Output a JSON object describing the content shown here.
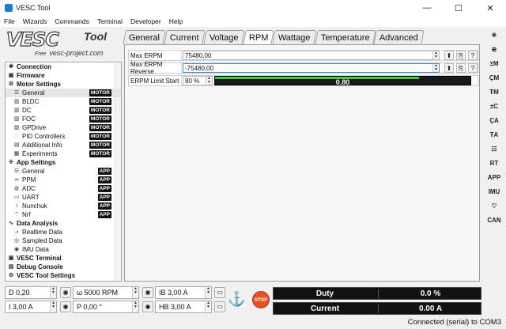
{
  "window": {
    "title": "VESC Tool",
    "controls": [
      "—",
      "☐",
      "✕"
    ]
  },
  "menu": [
    "File",
    "Wizards",
    "Commands",
    "Terminal",
    "Developer",
    "Help"
  ],
  "logo": {
    "brand": "VESC",
    "tool": "Tool",
    "free": "Free",
    "site": "vesc-project.com"
  },
  "tree": [
    {
      "kind": "group",
      "label": "Connection",
      "icon": "connection-icon"
    },
    {
      "kind": "group",
      "label": "Firmware",
      "icon": "firmware-icon"
    },
    {
      "kind": "group",
      "label": "Motor Settings",
      "icon": "motor-settings-icon"
    },
    {
      "kind": "child",
      "label": "General",
      "icon": "sliders-icon",
      "badge": "MOTOR",
      "selected": true
    },
    {
      "kind": "child",
      "label": "BLDC",
      "icon": "bldc-icon",
      "badge": "MOTOR"
    },
    {
      "kind": "child",
      "label": "DC",
      "icon": "dc-icon",
      "badge": "MOTOR"
    },
    {
      "kind": "child",
      "label": "FOC",
      "icon": "foc-icon",
      "badge": "MOTOR"
    },
    {
      "kind": "child",
      "label": "GPDrive",
      "icon": "gpdrive-icon",
      "badge": "MOTOR"
    },
    {
      "kind": "child",
      "label": "PID Controllers",
      "icon": "pid-icon",
      "badge": "MOTOR"
    },
    {
      "kind": "child",
      "label": "Additional Info",
      "icon": "info-icon",
      "badge": "MOTOR"
    },
    {
      "kind": "child",
      "label": "Experiments",
      "icon": "experiments-icon",
      "badge": "MOTOR"
    },
    {
      "kind": "group",
      "label": "App Settings",
      "icon": "app-settings-icon"
    },
    {
      "kind": "child",
      "label": "General",
      "icon": "sliders-icon",
      "badge": "APP"
    },
    {
      "kind": "child",
      "label": "PPM",
      "icon": "ppm-icon",
      "badge": "APP"
    },
    {
      "kind": "child",
      "label": "ADC",
      "icon": "adc-icon",
      "badge": "APP"
    },
    {
      "kind": "child",
      "label": "UART",
      "icon": "uart-icon",
      "badge": "APP"
    },
    {
      "kind": "child",
      "label": "Nunchuk",
      "icon": "nunchuk-icon",
      "badge": "APP"
    },
    {
      "kind": "child",
      "label": "Nrf",
      "icon": "nrf-icon",
      "badge": "APP"
    },
    {
      "kind": "group",
      "label": "Data Analysis",
      "icon": "data-analysis-icon"
    },
    {
      "kind": "child",
      "label": "Realtime Data",
      "icon": "realtime-icon"
    },
    {
      "kind": "child",
      "label": "Sampled Data",
      "icon": "sampled-icon"
    },
    {
      "kind": "child",
      "label": "IMU Data",
      "icon": "imu-data-icon"
    },
    {
      "kind": "group",
      "label": "VESC Terminal",
      "icon": "terminal-icon"
    },
    {
      "kind": "group",
      "label": "Debug Console",
      "icon": "debug-icon"
    },
    {
      "kind": "group",
      "label": "VESC Tool Settings",
      "icon": "settings-icon"
    }
  ],
  "tabs": [
    {
      "label": "General",
      "active": false
    },
    {
      "label": "Current",
      "active": false
    },
    {
      "label": "Voltage",
      "active": false
    },
    {
      "label": "RPM",
      "active": true
    },
    {
      "label": "Wattage",
      "active": false
    },
    {
      "label": "Temperature",
      "active": false
    },
    {
      "label": "Advanced",
      "active": false
    }
  ],
  "params": {
    "max_erpm": {
      "label": "Max ERPM",
      "value": "75480,00"
    },
    "max_erpm_reverse": {
      "label": "Max ERPM Reverse",
      "value": "-75480,00"
    },
    "erpm_limit_start": {
      "label": "ERPM Limit Start",
      "value": "80 %",
      "bar_text": "0.80",
      "bar_fraction": 0.8
    }
  },
  "param_buttons": {
    "upload": "⬆",
    "read": "⎘",
    "help": "?"
  },
  "right_toolbar": [
    "✳",
    "⊕",
    "±M",
    "ÇM",
    "ŦM",
    "±C",
    "ÇA",
    "ŦA",
    "☷",
    "RT",
    "APP",
    "IMU",
    "♡",
    "CAN"
  ],
  "controls": {
    "duty": {
      "value": "D 0,20"
    },
    "rpm": {
      "value": "ω 5000 RPM"
    },
    "ib": {
      "value": "IB 3,00 A"
    },
    "current": {
      "value": "I 3,00 A"
    },
    "position": {
      "value": "P 0,00 °"
    },
    "hb": {
      "value": "HB 3,00 A"
    },
    "stop_label": "STOP"
  },
  "meters": {
    "duty": {
      "name": "Duty",
      "value": "0.0 %",
      "fraction": 0.0
    },
    "current": {
      "name": "Current",
      "value": "0.00 A",
      "fraction": 0.0
    }
  },
  "status": "Connected (serial) to COM3",
  "colors": {
    "accent_green": "#3ad23a",
    "badge_bg": "#111111",
    "stop_red": "#e85020"
  }
}
